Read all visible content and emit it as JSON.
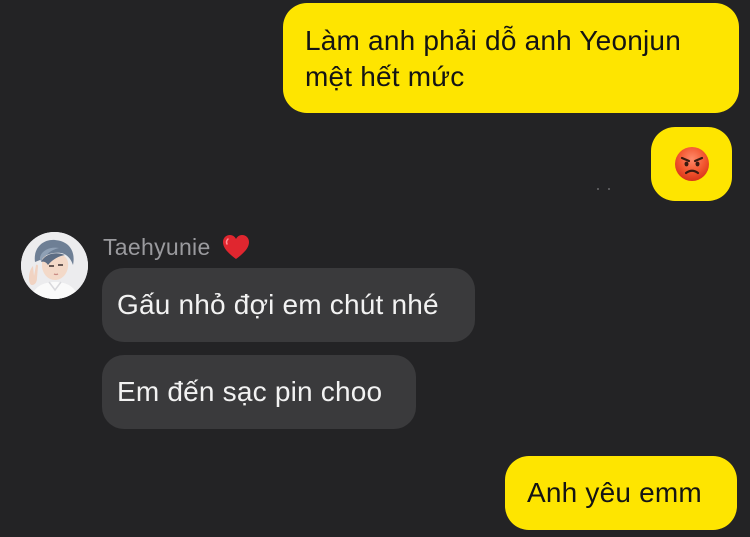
{
  "conversation": {
    "messages": [
      {
        "sender": "me",
        "text": "Làm anh phải dỗ anh Yeonjun\nmệt hết mức"
      },
      {
        "sender": "me",
        "emoji": "angry-face-icon"
      },
      {
        "sender": "Taehyunie",
        "text": "Gấu nhỏ đợi em chút nhé"
      },
      {
        "sender": "Taehyunie",
        "text": "Em đến sạc pin choo"
      },
      {
        "sender": "me",
        "text": "Anh yêu emm"
      }
    ],
    "contact": {
      "name": "Taehyunie",
      "name_icon": "red-heart-icon",
      "avatar_icon": "contact-avatar-icon"
    }
  },
  "colors": {
    "background": "#232325",
    "my_bubble": "#fee500",
    "their_bubble": "#3a3a3c",
    "my_text": "#141414",
    "their_text": "#f2f2f2",
    "sender_name": "#9a9a9e"
  }
}
